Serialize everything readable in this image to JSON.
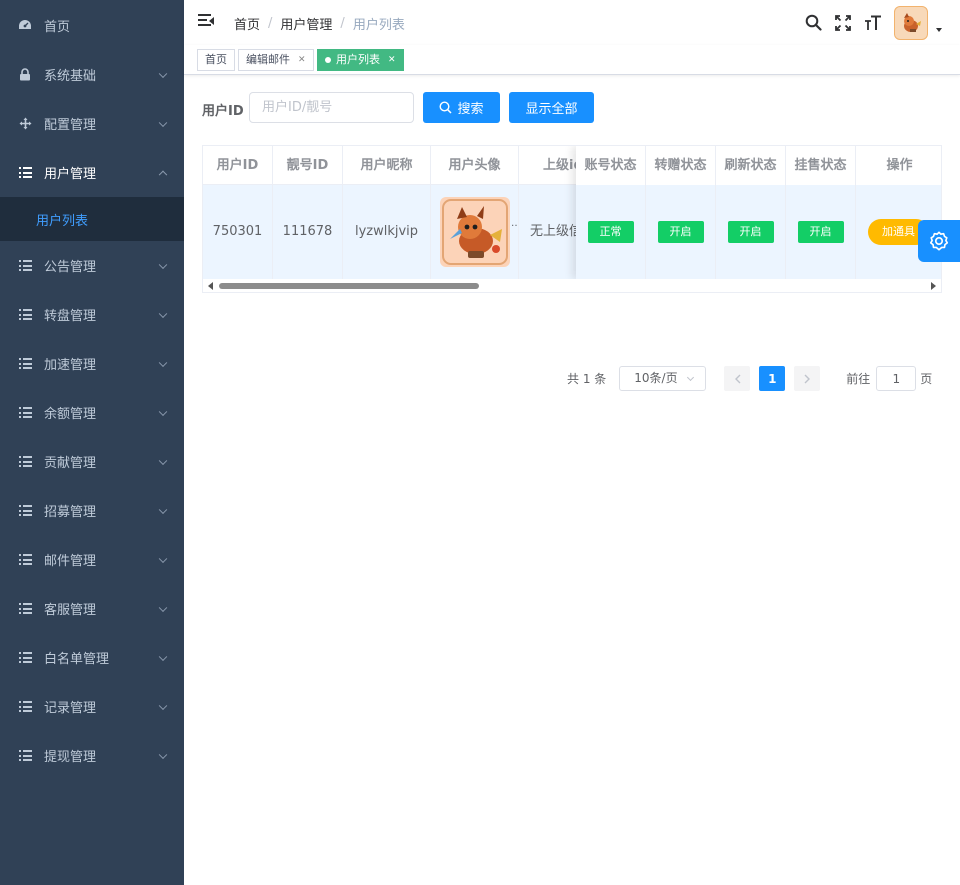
{
  "sidebar": {
    "items": [
      {
        "label": "首页",
        "icon": "dashboard-icon",
        "expandable": false
      },
      {
        "label": "系统基础",
        "icon": "lock-icon",
        "expandable": true
      },
      {
        "label": "配置管理",
        "icon": "move-icon",
        "expandable": true
      },
      {
        "label": "用户管理",
        "icon": "list-icon",
        "expandable": true,
        "expanded": true
      },
      {
        "label": "公告管理",
        "icon": "list-icon",
        "expandable": true
      },
      {
        "label": "转盘管理",
        "icon": "list-icon",
        "expandable": true
      },
      {
        "label": "加速管理",
        "icon": "list-icon",
        "expandable": true
      },
      {
        "label": "余额管理",
        "icon": "list-icon",
        "expandable": true
      },
      {
        "label": "贡献管理",
        "icon": "list-icon",
        "expandable": true
      },
      {
        "label": "招募管理",
        "icon": "list-icon",
        "expandable": true
      },
      {
        "label": "邮件管理",
        "icon": "list-icon",
        "expandable": true
      },
      {
        "label": "客服管理",
        "icon": "list-icon",
        "expandable": true
      },
      {
        "label": "白名单管理",
        "icon": "list-icon",
        "expandable": true
      },
      {
        "label": "记录管理",
        "icon": "list-icon",
        "expandable": true
      },
      {
        "label": "提现管理",
        "icon": "list-icon",
        "expandable": true
      }
    ],
    "submenu": {
      "label": "用户列表"
    }
  },
  "navbar": {
    "breadcrumb": [
      "首页",
      "用户管理",
      "用户列表"
    ],
    "icons": [
      "search-icon",
      "fullscreen-icon",
      "font-size-icon"
    ]
  },
  "tags": [
    {
      "label": "首页",
      "active": false,
      "closable": false
    },
    {
      "label": "编辑邮件",
      "active": false,
      "closable": true
    },
    {
      "label": "用户列表",
      "active": true,
      "closable": true
    }
  ],
  "search": {
    "label": "用户ID",
    "placeholder": "用户ID/靓号",
    "value": "",
    "search_button": "搜索",
    "show_all_button": "显示全部"
  },
  "table": {
    "columns": [
      "用户ID",
      "靓号ID",
      "用户昵称",
      "用户头像",
      "上级id",
      "账号状态",
      "转赠状态",
      "刷新状态",
      "挂售状态",
      "操作"
    ],
    "rows": [
      {
        "user_id": "750301",
        "pretty_id": "111678",
        "nickname": "lyzwlkjvip",
        "parent": "无上级信",
        "account_status": "正常",
        "transfer_status": "开启",
        "refresh_status": "开启",
        "sale_status": "开启",
        "action": "加通具"
      }
    ]
  },
  "pagination": {
    "total": "共 1 条",
    "page_size": "10条/页",
    "current_page": "1",
    "jump_prefix": "前往",
    "jump_value": "1",
    "jump_suffix": "页"
  },
  "colors": {
    "sidebar_bg": "#304156",
    "sidebar_active": "#409eff",
    "primary": "#1890ff",
    "success": "#13ce66",
    "warning": "#ffba00",
    "tag_active": "#42b983"
  }
}
